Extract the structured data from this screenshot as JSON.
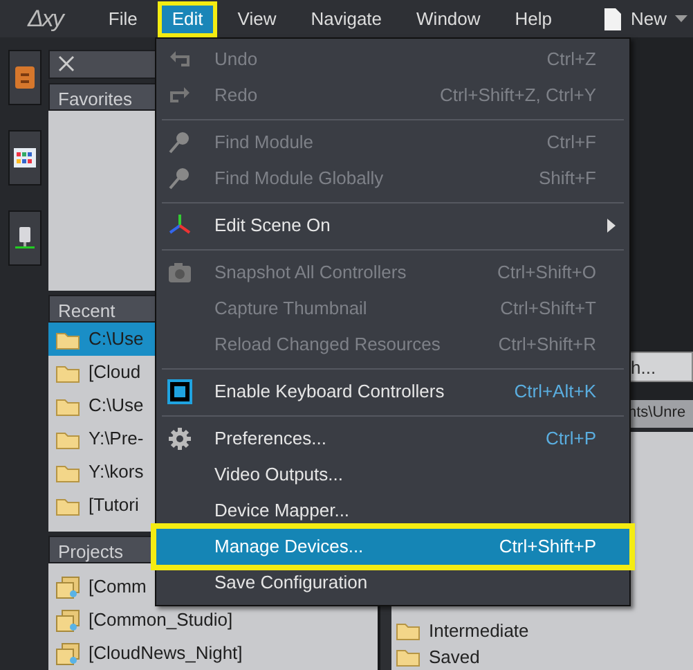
{
  "menubar": {
    "logo": "Δxy",
    "items": [
      {
        "label": "File",
        "selected": false
      },
      {
        "label": "Edit",
        "selected": true,
        "annotated": true
      },
      {
        "label": "View",
        "selected": false
      },
      {
        "label": "Navigate",
        "selected": false
      },
      {
        "label": "Window",
        "selected": false
      },
      {
        "label": "Help",
        "selected": false
      }
    ],
    "new_button": {
      "label": "New"
    }
  },
  "left_panel": {
    "favorites": {
      "title": "Favorites"
    },
    "recent": {
      "title": "Recent",
      "rows": [
        {
          "label": "C:\\Use",
          "selected": true
        },
        {
          "label": "[Cloud",
          "selected": false
        },
        {
          "label": "C:\\Use",
          "selected": false
        },
        {
          "label": "Y:\\Pre-",
          "selected": false
        },
        {
          "label": "Y:\\kors",
          "selected": false
        },
        {
          "label": "[Tutori",
          "selected": false
        }
      ]
    },
    "projects": {
      "title": "Projects",
      "rows": [
        {
          "label": "[Comm"
        },
        {
          "label": "[Common_Studio]"
        },
        {
          "label": "[CloudNews_Night]"
        }
      ]
    }
  },
  "right_panel": {
    "search": {
      "placeholder": "h..."
    },
    "path": "nts\\Unre",
    "files": [
      {
        "label": "Intermediate"
      },
      {
        "label": "Saved"
      }
    ]
  },
  "edit_menu": {
    "items": [
      {
        "kind": "item",
        "label": "Undo",
        "shortcut": "Ctrl+Z",
        "disabled": true,
        "selected": false
      },
      {
        "kind": "item",
        "label": "Redo",
        "shortcut": "Ctrl+Shift+Z, Ctrl+Y",
        "disabled": true,
        "selected": false
      },
      {
        "kind": "separator"
      },
      {
        "kind": "item",
        "label": "Find Module",
        "shortcut": "Ctrl+F",
        "disabled": true,
        "selected": false
      },
      {
        "kind": "item",
        "label": "Find Module Globally",
        "shortcut": "Shift+F",
        "disabled": true,
        "selected": false
      },
      {
        "kind": "separator"
      },
      {
        "kind": "submenu",
        "label": "Edit Scene On",
        "disabled": false,
        "selected": false
      },
      {
        "kind": "separator"
      },
      {
        "kind": "item",
        "label": "Snapshot All Controllers",
        "shortcut": "Ctrl+Shift+O",
        "disabled": true,
        "selected": false
      },
      {
        "kind": "item",
        "label": "Capture Thumbnail",
        "shortcut": "Ctrl+Shift+T",
        "disabled": true,
        "selected": false
      },
      {
        "kind": "item",
        "label": "Reload Changed Resources",
        "shortcut": "Ctrl+Shift+R",
        "disabled": true,
        "selected": false
      },
      {
        "kind": "separator"
      },
      {
        "kind": "checkbox",
        "label": "Enable Keyboard Controllers",
        "shortcut": "Ctrl+Alt+K",
        "checked": true,
        "disabled": false,
        "selected": false
      },
      {
        "kind": "separator"
      },
      {
        "kind": "item",
        "label": "Preferences...",
        "shortcut": "Ctrl+P",
        "disabled": false,
        "selected": false
      },
      {
        "kind": "item",
        "label": "Video Outputs...",
        "disabled": false,
        "selected": false
      },
      {
        "kind": "item",
        "label": "Device Mapper...",
        "disabled": false,
        "selected": false
      },
      {
        "kind": "item",
        "label": "Manage Devices...",
        "shortcut": "Ctrl+Shift+P",
        "disabled": false,
        "selected": true,
        "annotated": true
      },
      {
        "kind": "item",
        "label": "Save Configuration",
        "disabled": false,
        "selected": false
      }
    ]
  }
}
